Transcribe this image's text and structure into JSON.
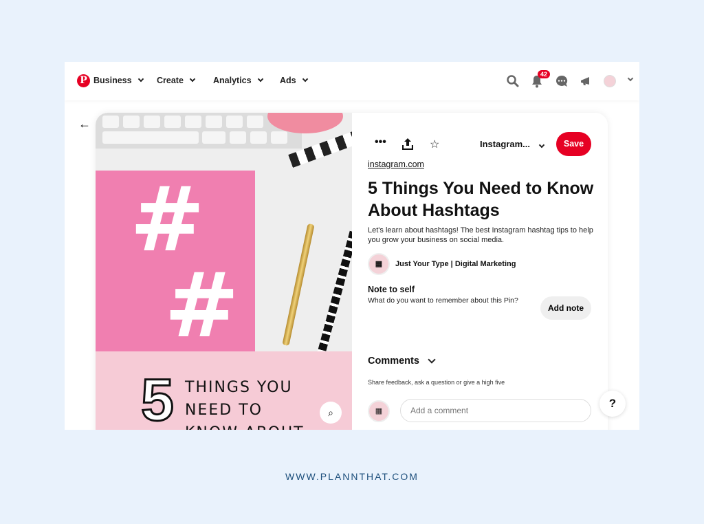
{
  "header": {
    "nav": [
      {
        "label": "Business"
      },
      {
        "label": "Create"
      },
      {
        "label": "Analytics"
      },
      {
        "label": "Ads"
      }
    ],
    "notification_count": "42"
  },
  "pin": {
    "image_text": {
      "number": "5",
      "line1": "THINGS YOU",
      "line2": "NEED TO",
      "line3": "KNOW ABOUT"
    },
    "board_select": "Instagram...",
    "save_label": "Save",
    "source_link": "instagram.com",
    "title": "5 Things You Need to Know About Hashtags",
    "description": "Let's learn about hashtags! The best Instagram hashtag tips to help you grow your business on social media.",
    "author": "Just Your Type | Digital Marketing",
    "note_heading": "Note to self",
    "note_prompt": "What do you want to remember about this Pin?",
    "add_note_label": "Add note",
    "comments_heading": "Comments",
    "comments_sub": "Share feedback, ask a question or give a high five",
    "comment_placeholder": "Add a comment"
  },
  "help_label": "?",
  "footer": "WWW.PLANNTHAT.COM",
  "colors": {
    "brand": "#e60023",
    "highlight_ring": "#8fc3ee",
    "background": "#e9f2fc"
  }
}
